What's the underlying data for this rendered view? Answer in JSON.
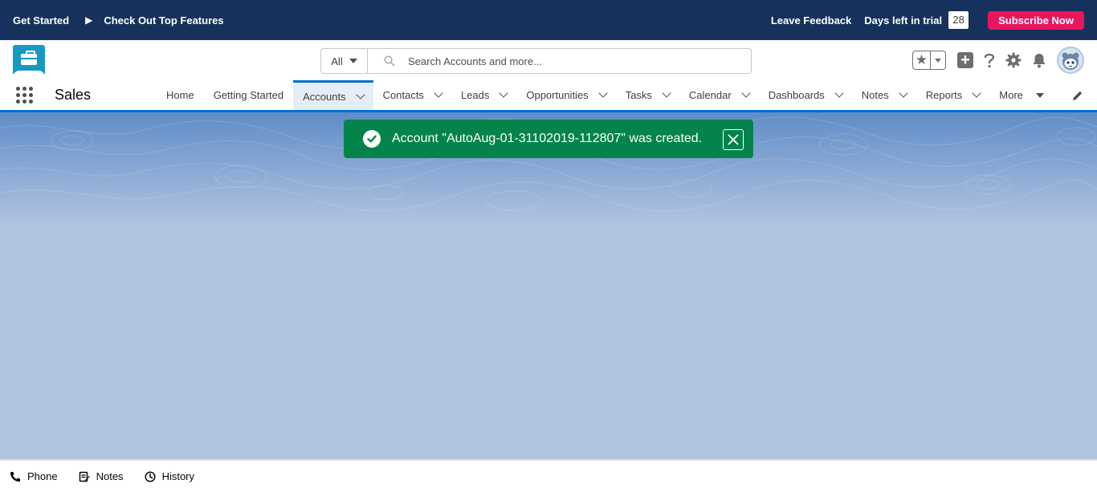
{
  "trial_bar": {
    "get_started": "Get Started",
    "check_out": "Check Out Top Features",
    "leave_feedback": "Leave Feedback",
    "days_left_label": "Days left in trial",
    "days_left": "28",
    "subscribe": "Subscribe Now"
  },
  "search": {
    "scope": "All",
    "placeholder": "Search Accounts and more..."
  },
  "nav": {
    "app_name": "Sales",
    "items": [
      {
        "label": "Home"
      },
      {
        "label": "Getting Started"
      },
      {
        "label": "Accounts"
      },
      {
        "label": "Contacts"
      },
      {
        "label": "Leads"
      },
      {
        "label": "Opportunities"
      },
      {
        "label": "Tasks"
      },
      {
        "label": "Calendar"
      },
      {
        "label": "Dashboards"
      },
      {
        "label": "Notes"
      },
      {
        "label": "Reports"
      },
      {
        "label": "More"
      }
    ]
  },
  "toast": {
    "message": "Account \"AutoAug-01-31102019-112807\" was created."
  },
  "utility_bar": {
    "items": [
      {
        "label": "Phone",
        "icon": "phone-icon"
      },
      {
        "label": "Notes",
        "icon": "notes-icon"
      },
      {
        "label": "History",
        "icon": "history-icon"
      }
    ]
  },
  "colors": {
    "trial_bar_bg": "#16325c",
    "subscribe_bg": "#e8175d",
    "toast_success": "#04844b",
    "brand_blue": "#0070d2",
    "page_bg": "#b0c4df"
  }
}
